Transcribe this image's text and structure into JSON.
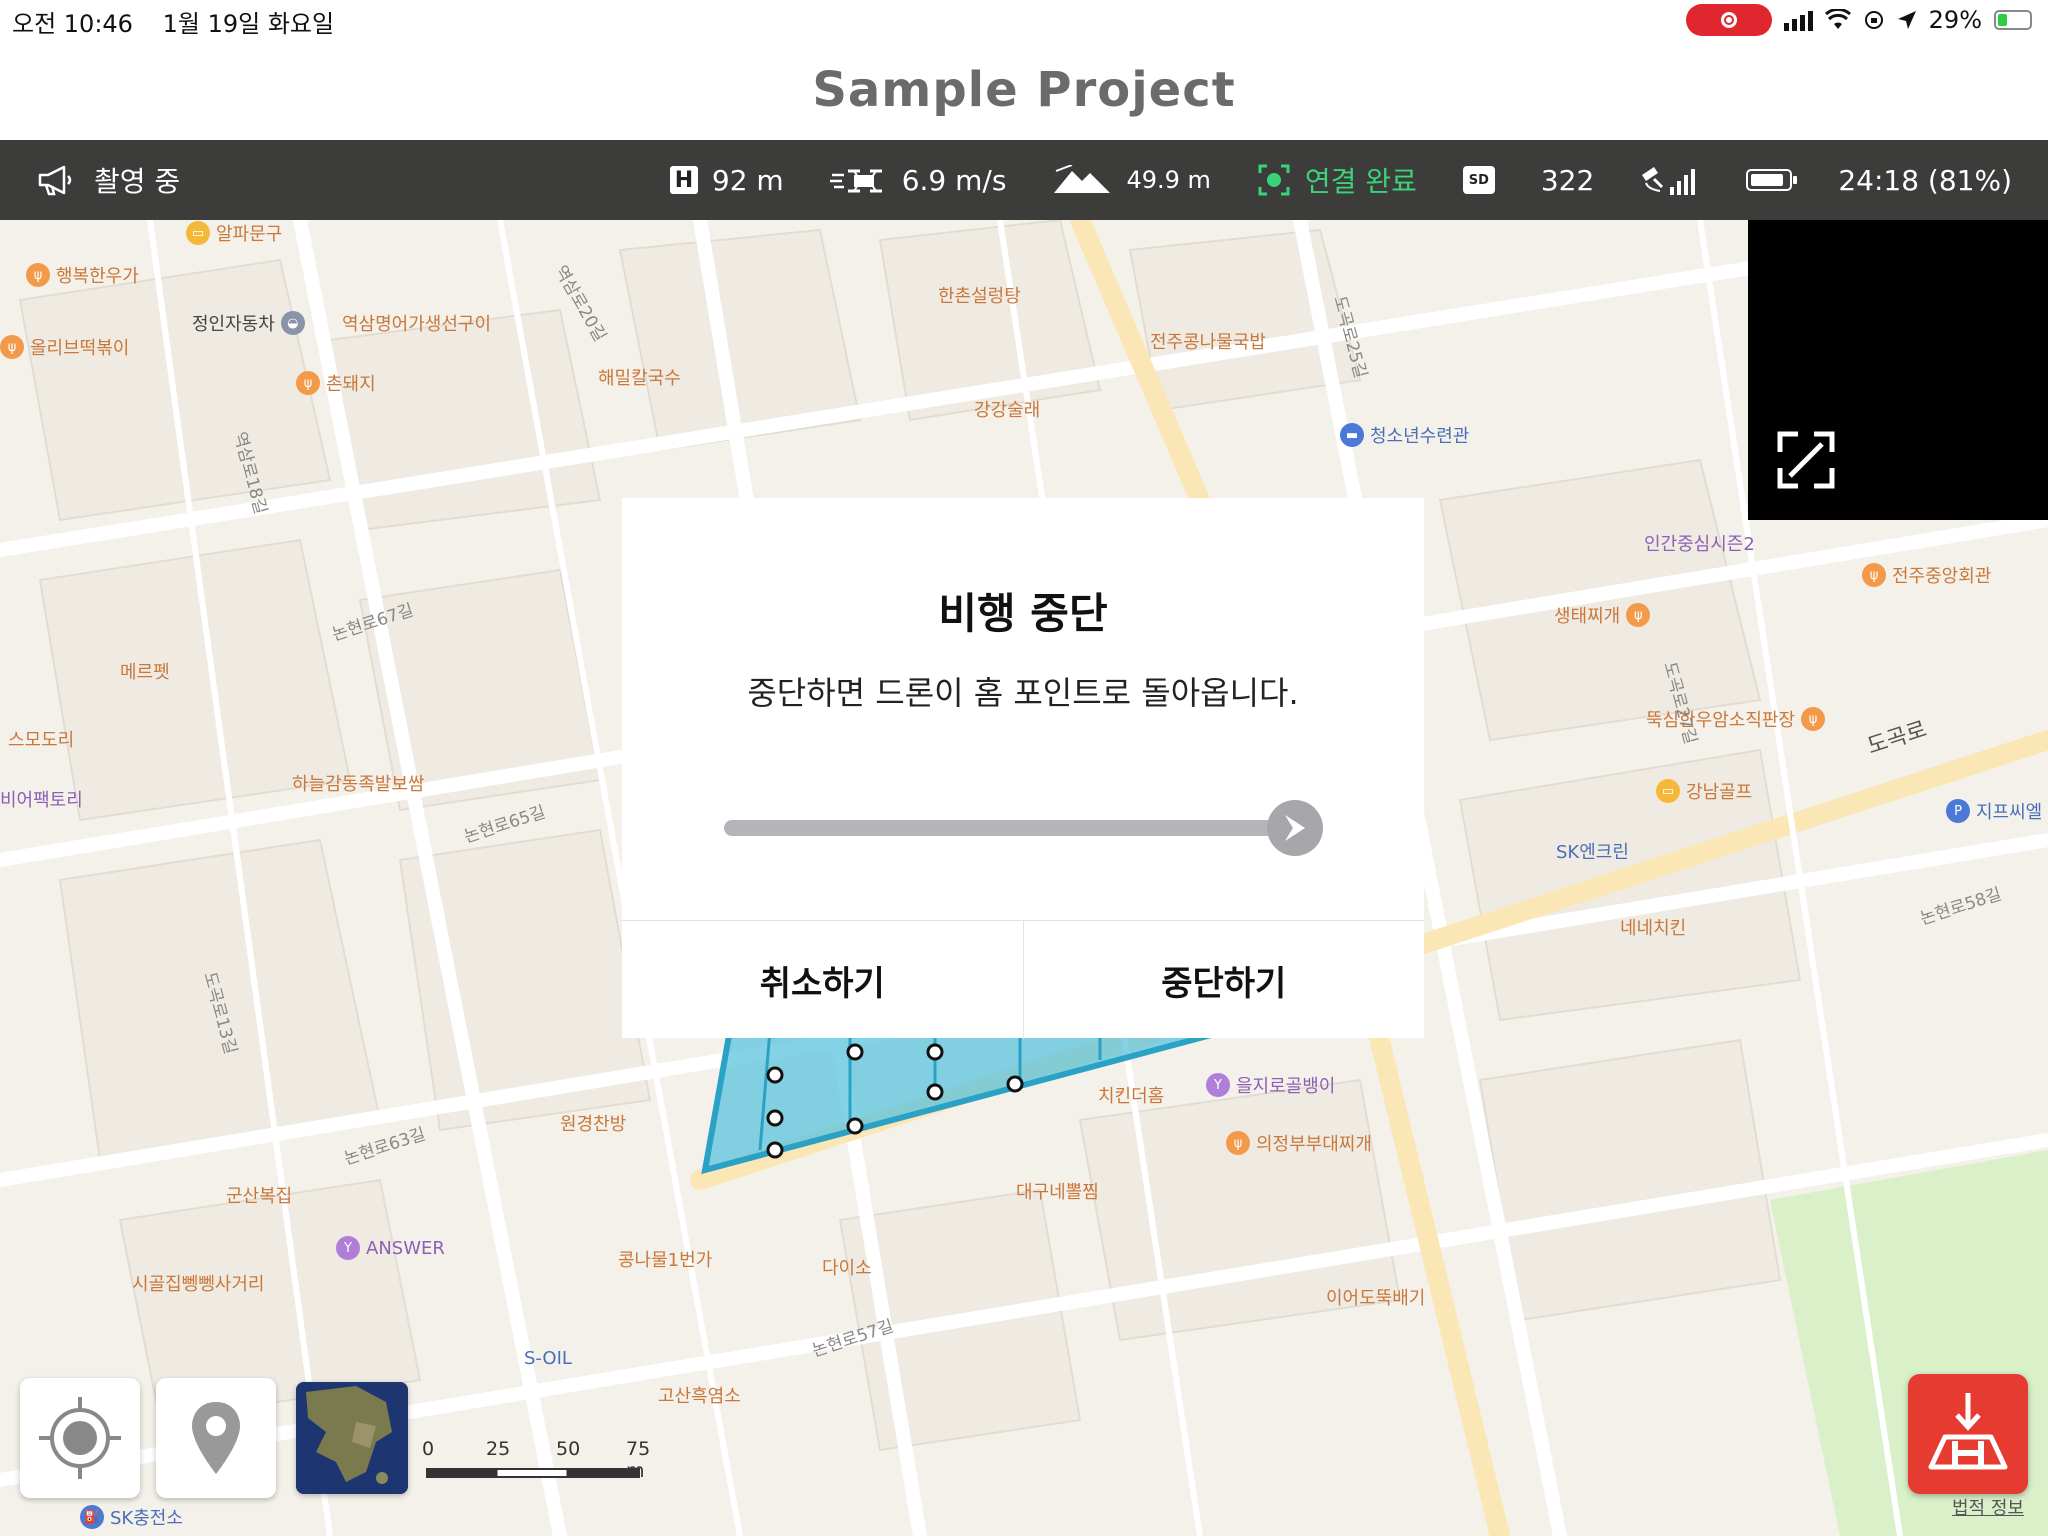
{
  "status_bar": {
    "time": "오전 10:46",
    "date": "1월 19일 화요일",
    "battery_percent": "29%"
  },
  "title": "Sample Project",
  "telemetry": {
    "mode_label": "촬영 중",
    "height": "92 m",
    "speed": "6.9 m/s",
    "distance": "49.9 m",
    "connection": "연결 완료",
    "sd_badge": "SD",
    "sd_count": "322",
    "battery": "24:18 (81%)"
  },
  "dialog": {
    "title": "비행 중단",
    "message": "중단하면 드론이 홈 포인트로 돌아옵니다.",
    "cancel_label": "취소하기",
    "stop_label": "중단하기"
  },
  "map": {
    "pois": [
      {
        "label": "행복한우가",
        "kind": "food"
      },
      {
        "label": "알파문구",
        "kind": "shop"
      },
      {
        "label": "정인자동차",
        "kind": "car"
      },
      {
        "label": "역삼명어가생선구이",
        "kind": "food"
      },
      {
        "label": "올리브떡볶이",
        "kind": "food"
      },
      {
        "label": "촌돼지",
        "kind": "food"
      },
      {
        "label": "해밀칼국수",
        "kind": "food"
      },
      {
        "label": "한촌설렁탕",
        "kind": "food"
      },
      {
        "label": "강강술래",
        "kind": "food"
      },
      {
        "label": "전주콩나물국밥",
        "kind": "food"
      },
      {
        "label": "청소년수련관",
        "kind": "hotel"
      },
      {
        "label": "인간중심시즌2",
        "kind": "bar"
      },
      {
        "label": "전주중앙회관",
        "kind": "food"
      },
      {
        "label": "생태찌개",
        "kind": "food"
      },
      {
        "label": "뚝심한우암소직판장",
        "kind": "food"
      },
      {
        "label": "지프씨엘",
        "kind": "parking"
      },
      {
        "label": "강남골프",
        "kind": "shop"
      },
      {
        "label": "SK엔크린",
        "kind": "gas"
      },
      {
        "label": "네네치킨",
        "kind": "food"
      },
      {
        "label": "메르펫",
        "kind": "shop"
      },
      {
        "label": "스모도리",
        "kind": "food"
      },
      {
        "label": "비어팩토리",
        "kind": "bar"
      },
      {
        "label": "하늘감동족발보쌈",
        "kind": "food"
      },
      {
        "label": "원경찬방",
        "kind": "food"
      },
      {
        "label": "치킨더홈",
        "kind": "food"
      },
      {
        "label": "을지로골뱅이",
        "kind": "bar"
      },
      {
        "label": "의정부부대찌개",
        "kind": "food"
      },
      {
        "label": "대구네뽈찜",
        "kind": "food"
      },
      {
        "label": "군산복집",
        "kind": "food"
      },
      {
        "label": "ANSWER",
        "kind": "bar"
      },
      {
        "label": "시골집뼁뼁사거리",
        "kind": "food"
      },
      {
        "label": "콩나물1번가",
        "kind": "food"
      },
      {
        "label": "다이소",
        "kind": "shop"
      },
      {
        "label": "S-OIL",
        "kind": "gas"
      },
      {
        "label": "고산흑염소",
        "kind": "food"
      },
      {
        "label": "이어도뚝배기",
        "kind": "food"
      },
      {
        "label": "SK충전소",
        "kind": "gas"
      }
    ],
    "streets": [
      "논현로67길",
      "논현로65길",
      "논현로63길",
      "논현로57길",
      "논현로58길",
      "도곡로",
      "역삼로20길",
      "역삼로18길",
      "도곡로25길",
      "도곡로27길",
      "도곡로13길"
    ],
    "scale_labels": [
      "0",
      "25",
      "50",
      "75 m"
    ],
    "legal_link": "법적 정보"
  },
  "colors": {
    "record": "#e0262f",
    "connected": "#3bd37a",
    "home_button": "#e53b30",
    "flight_area": "#5bc3dd"
  }
}
